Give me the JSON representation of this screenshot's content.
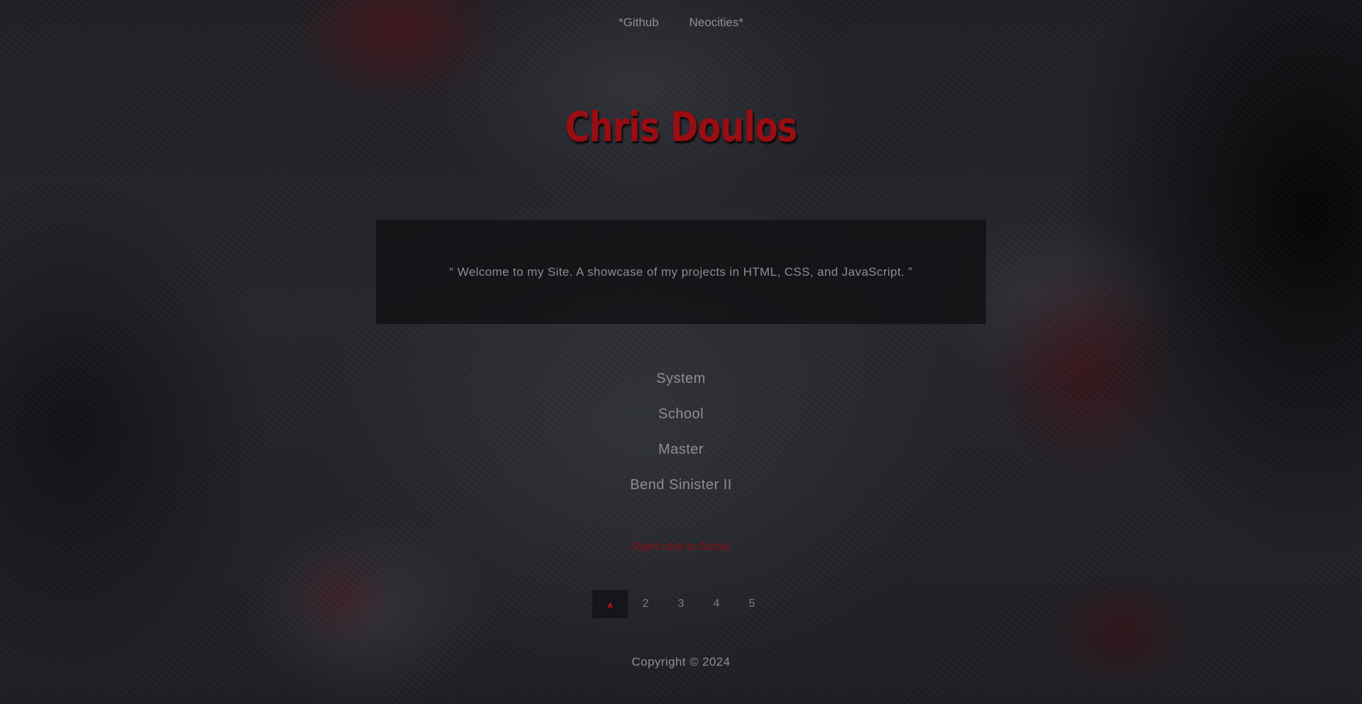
{
  "nav": {
    "links": [
      {
        "label": "*Github"
      },
      {
        "label": "Neocities*"
      }
    ]
  },
  "header": {
    "title": "Chris Doulos"
  },
  "intro": {
    "text": "“ Welcome to my Site. A showcase of my projects in HTML, CSS, and JavaScript. ”"
  },
  "projects": {
    "items": [
      {
        "label": "System"
      },
      {
        "label": "School"
      },
      {
        "label": "Master"
      },
      {
        "label": "Bend Sinister II"
      }
    ]
  },
  "social": {
    "hint": "Right click to Social"
  },
  "pagination": {
    "current_icon": "▲",
    "pages": [
      "2",
      "3",
      "4",
      "5"
    ]
  },
  "footer": {
    "copyright": "Copyright © 2024"
  },
  "colors": {
    "accent": "#9a0d12",
    "text_muted": "#8e8e94",
    "panel": "#111114"
  }
}
